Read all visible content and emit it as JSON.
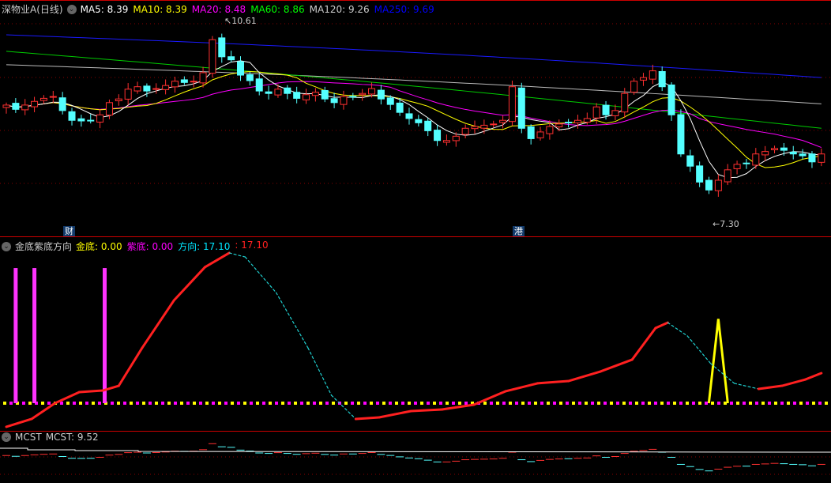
{
  "main": {
    "title": "深物业A(日线)",
    "ma": [
      {
        "label": "MA5: 8.39",
        "color": "#ffffff"
      },
      {
        "label": "MA10: 8.39",
        "color": "#ffff00"
      },
      {
        "label": "MA20: 8.48",
        "color": "#ff00ff"
      },
      {
        "label": "MA60: 8.86",
        "color": "#00ff00"
      },
      {
        "label": "MA120: 9.26",
        "color": "#cccccc"
      },
      {
        "label": "MA250: 9.69",
        "color": "#0000ff"
      }
    ],
    "high_label": "10.61",
    "low_label": "7.30",
    "tags": [
      "财",
      "港"
    ],
    "closes": [
      9.24,
      9.17,
      9.24,
      9.3,
      9.35,
      9.38,
      9.15,
      8.99,
      8.98,
      8.99,
      9.08,
      9.28,
      9.34,
      9.5,
      9.54,
      9.47,
      9.51,
      9.56,
      9.63,
      9.61,
      9.63,
      9.77,
      10.31,
      10.03,
      9.98,
      9.73,
      9.64,
      9.47,
      9.43,
      9.5,
      9.43,
      9.35,
      9.41,
      9.45,
      9.34,
      9.28,
      9.38,
      9.38,
      9.43,
      9.51,
      9.34,
      9.25,
      9.12,
      9.02,
      8.95,
      8.82,
      8.66,
      8.66,
      8.73,
      8.86,
      8.89,
      8.91,
      8.93,
      8.99,
      9.54,
      8.86,
      8.69,
      8.8,
      8.89,
      8.93,
      8.95,
      8.99,
      9.02,
      9.21,
      9.08,
      9.15,
      9.43,
      9.63,
      9.69,
      9.8,
      9.54,
      9.08,
      8.44,
      8.24,
      7.98,
      7.85,
      8.01,
      8.18,
      8.27,
      8.28,
      8.44,
      8.48,
      8.53,
      8.5,
      8.44,
      8.41,
      8.31,
      8.44
    ],
    "long_ma": {
      "ma60": [
        10.12,
        8.86
      ],
      "ma120": [
        9.9,
        9.26
      ],
      "ma250": [
        10.39,
        9.69
      ]
    }
  },
  "indicator": {
    "title": "金底紫底方向",
    "items": [
      {
        "label": "金底: 0.00",
        "color": "#ffff00"
      },
      {
        "label": "紫底: 0.00",
        "color": "#ff00ff"
      },
      {
        "label": "方向: 17.10",
        "color": "#00e5ff"
      },
      {
        "label": ": 17.10",
        "color": "#ff2020"
      }
    ],
    "curve_keys": [
      [
        0,
        -13.5
      ],
      [
        2.7,
        -9
      ],
      [
        5.2,
        0
      ],
      [
        7.8,
        6.3
      ],
      [
        10.3,
        7.2
      ],
      [
        12,
        9.9
      ],
      [
        14.5,
        31.5
      ],
      [
        17.9,
        58.6
      ],
      [
        21.2,
        77.5
      ],
      [
        23.8,
        85.6
      ],
      [
        25.5,
        83.3
      ],
      [
        28.8,
        63
      ],
      [
        32.2,
        31.5
      ],
      [
        34.7,
        4.5
      ],
      [
        37.3,
        -9
      ],
      [
        39.8,
        -8.1
      ],
      [
        43.2,
        -4.5
      ],
      [
        46.5,
        -3.6
      ],
      [
        49.9,
        -0.9
      ],
      [
        53.3,
        6.8
      ],
      [
        56.7,
        11.3
      ],
      [
        60,
        12.6
      ],
      [
        63.4,
        18
      ],
      [
        66.8,
        24.8
      ],
      [
        69.3,
        42.8
      ],
      [
        70.6,
        45.9
      ],
      [
        72.7,
        38.3
      ],
      [
        75.2,
        22.5
      ],
      [
        77.7,
        11.3
      ],
      [
        80.3,
        8.1
      ],
      [
        82.8,
        9.9
      ],
      [
        85.3,
        13.5
      ],
      [
        87,
        17.1
      ]
    ],
    "purple_bars": [
      1,
      3,
      10.5
    ],
    "purple_value": 77,
    "gold_spike": 76,
    "gold_value": 48
  },
  "mcst": {
    "title": "MCST",
    "label": "MCST: 9.52",
    "value": 9.52
  }
}
